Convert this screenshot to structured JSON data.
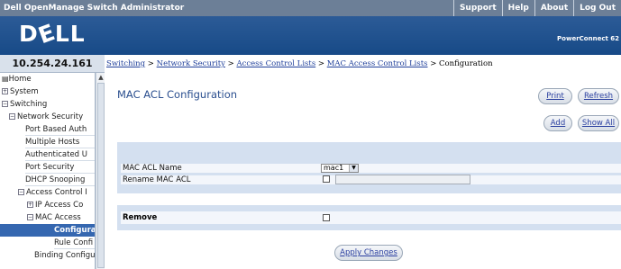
{
  "topbar": {
    "title": "Dell OpenManage Switch Administrator",
    "links": [
      "Support",
      "Help",
      "About",
      "Log Out"
    ]
  },
  "banner": {
    "logo": "DELL",
    "product": "PowerConnect 62"
  },
  "ip": "10.254.24.161",
  "breadcrumb": {
    "links": [
      "Switching",
      "Network Security",
      "Access Control Lists",
      "MAC Access Control Lists"
    ],
    "separator": " > ",
    "current": "Configuration"
  },
  "tree": {
    "home": "Home",
    "system": "System",
    "switching": "Switching",
    "network_security": "Network Security",
    "port_based_auth": "Port Based Auth",
    "multiple_hosts": "Multiple Hosts",
    "authenticated": "Authenticated U",
    "port_security": "Port Security",
    "dhcp_snooping": "DHCP Snooping",
    "access_control": "Access Control I",
    "ip_access": "IP Access Co",
    "mac_access": "MAC Access",
    "configuration": "Configura",
    "rule_config": "Rule Confi",
    "binding_config": "Binding Configur"
  },
  "page": {
    "title": "MAC ACL Configuration",
    "buttons": {
      "print": "Print",
      "refresh": "Refresh",
      "add": "Add",
      "show_all": "Show All",
      "apply": "Apply Changes"
    },
    "fields": {
      "acl_name_label": "MAC ACL Name",
      "acl_name_value": "mac1",
      "rename_label": "Rename MAC ACL",
      "remove_label": "Remove"
    }
  },
  "colors": {
    "topbar": "#6c7f97",
    "banner": "#174a87",
    "panel": "#d4e0f0",
    "selected": "#3567b0",
    "link": "#1f3f9a"
  }
}
